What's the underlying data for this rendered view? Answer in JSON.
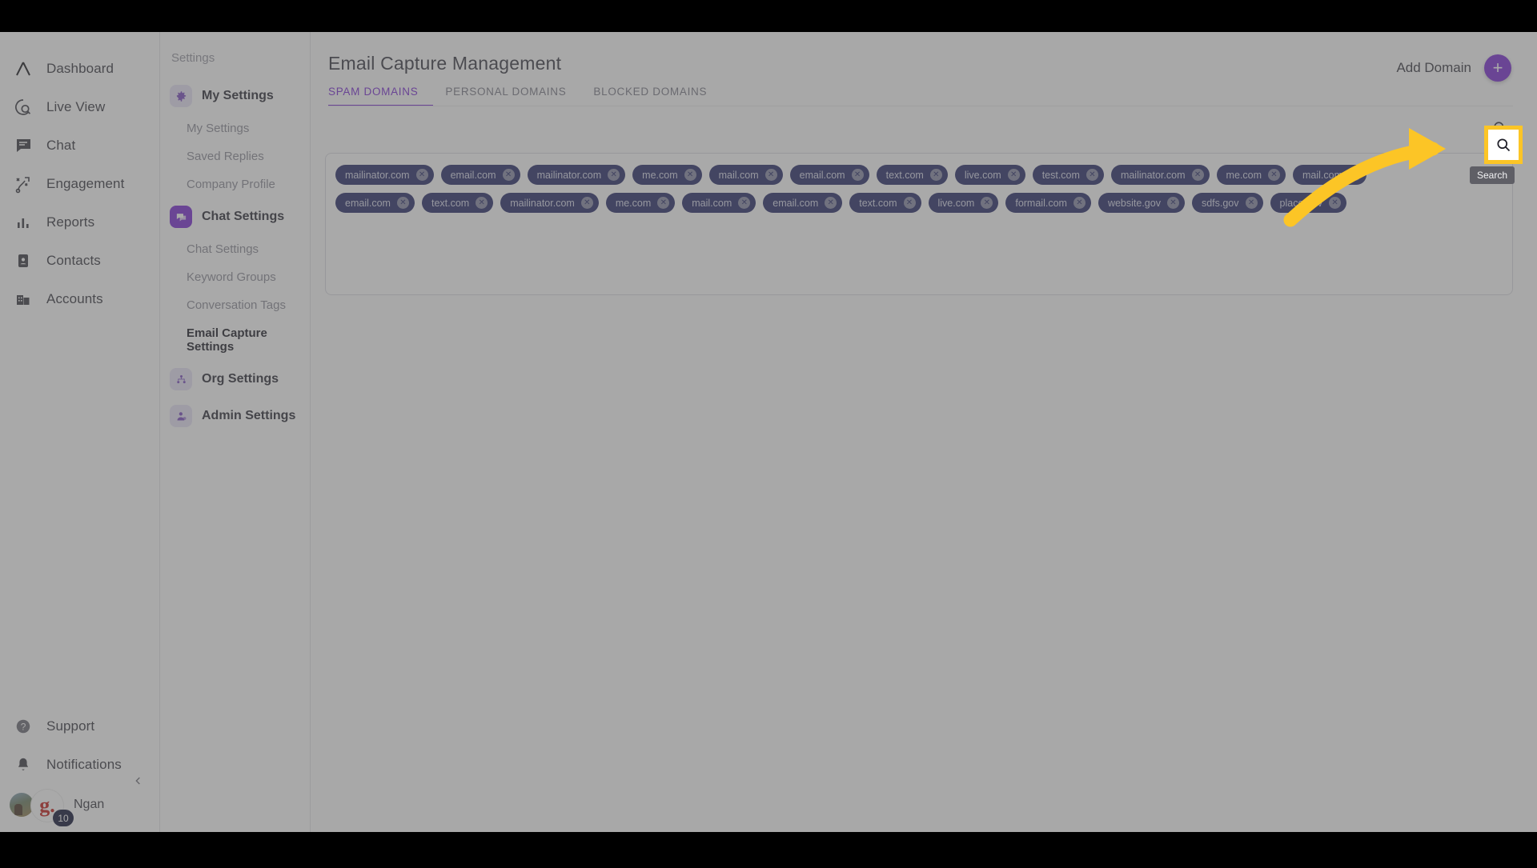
{
  "sidebar": {
    "items": [
      {
        "label": "Dashboard",
        "icon": "logo-caret-icon"
      },
      {
        "label": "Live View",
        "icon": "live-view-icon"
      },
      {
        "label": "Chat",
        "icon": "chat-bubble-icon"
      },
      {
        "label": "Engagement",
        "icon": "engagement-icon"
      },
      {
        "label": "Reports",
        "icon": "bar-chart-icon"
      },
      {
        "label": "Contacts",
        "icon": "contact-card-icon"
      },
      {
        "label": "Accounts",
        "icon": "building-icon"
      }
    ],
    "bottom_items": [
      {
        "label": "Support",
        "icon": "help-circle-icon"
      },
      {
        "label": "Notifications",
        "icon": "bell-icon"
      }
    ],
    "user": {
      "name": "Ngan",
      "badge_letter": "g.",
      "count": "10"
    }
  },
  "settings_tree": {
    "title": "Settings",
    "groups": [
      {
        "label": "My Settings",
        "icon": "gear-icon",
        "active": false,
        "children": [
          "My Settings",
          "Saved Replies",
          "Company Profile"
        ]
      },
      {
        "label": "Chat Settings",
        "icon": "chat-settings-icon",
        "active": true,
        "children": [
          "Chat Settings",
          "Keyword Groups",
          "Conversation Tags",
          "Email Capture Settings"
        ]
      },
      {
        "label": "Org Settings",
        "icon": "org-chart-icon",
        "active": false,
        "children": []
      },
      {
        "label": "Admin Settings",
        "icon": "admin-person-icon",
        "active": false,
        "children": []
      }
    ],
    "current_child": "Email Capture Settings"
  },
  "main": {
    "title": "Email Capture Management",
    "tabs": [
      {
        "label": "SPAM DOMAINS",
        "active": true
      },
      {
        "label": "PERSONAL DOMAINS",
        "active": false
      },
      {
        "label": "BLOCKED DOMAINS",
        "active": false
      }
    ],
    "add_domain_label": "Add Domain",
    "add_icon": "plus-icon",
    "search_icon": "search-icon",
    "chip_remove_icon": "close-circle-icon",
    "domain_rows": [
      [
        "mailinator.com",
        "email.com",
        "mailinator.com",
        "me.com",
        "mail.com",
        "email.com",
        "text.com",
        "live.com",
        "test.com",
        "mailinator.com",
        "me.com",
        "mail.com"
      ],
      [
        "email.com",
        "text.com",
        "mailinator.com",
        "me.com",
        "mail.com",
        "email.com",
        "text.com",
        "live.com",
        "formail.com",
        "website.gov",
        "sdfs.gov",
        "place.gov"
      ]
    ]
  },
  "annotation": {
    "highlight_target": "search-icon",
    "tooltip": "Search",
    "highlight_color": "#fcc526"
  },
  "colors": {
    "accent": "#7b2fd4",
    "chip_bg": "#2b2f6b",
    "chip_text": "#d7d9ea",
    "highlight": "#fcc526",
    "badge_bg": "#13183a"
  }
}
